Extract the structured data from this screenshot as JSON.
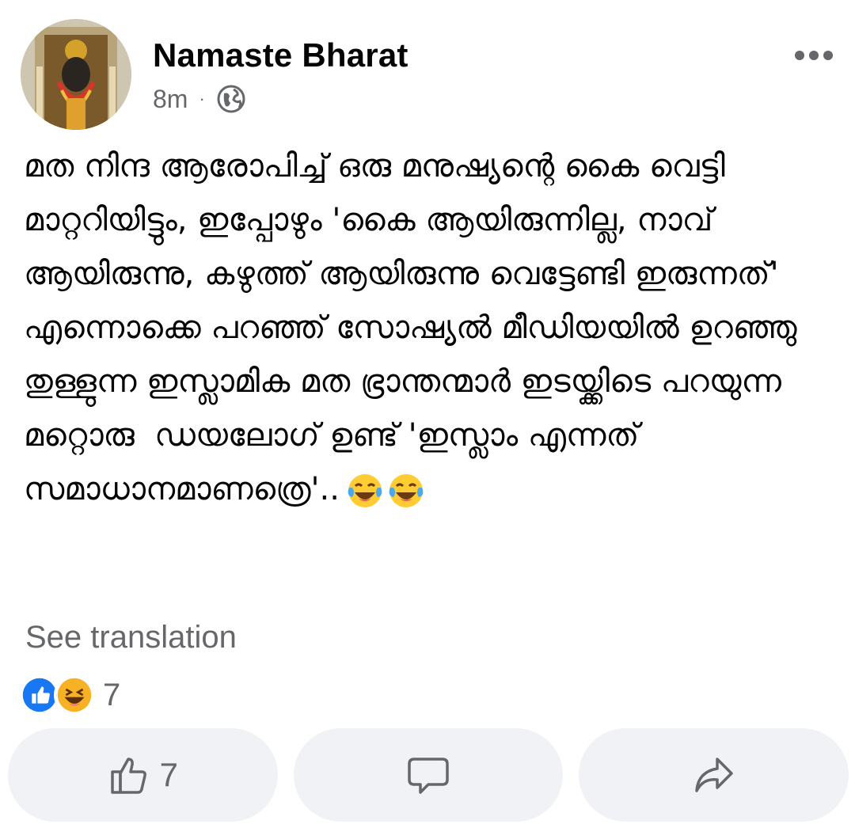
{
  "post": {
    "author": "Namaste Bharat",
    "time": "8m",
    "separator": "·",
    "audience_icon": "globe-icon",
    "text": "മത നിന്ദ ആരോപിച്ച് ഒരു മനുഷ്യന്റെ കൈ വെട്ടി മാറ്ററിയിട്ടും, ഇപ്പോഴും 'കൈ ആയിരുന്നില്ല, നാവ് ആയിരുന്നു, കഴുത്ത് ആയിരുന്നു വെട്ടേണ്ടി ഇരുന്നത്' എന്നൊക്കെ പറഞ്ഞ് സോഷ്യൽ മീഡിയയിൽ ഉറഞ്ഞു തുള്ളുന്ന ഇസ്ലാമിക മത ഭ്രാന്തന്മാർ ഇടയ്ക്കിടെ പറയുന്ന മറ്റൊരു  ഡയലോഗ് ഉണ്ട് 'ഇസ്ലാം എന്നത് സമാധാനമാണത്രെ'..",
    "trailing_emojis": "laughing-with-tears-emoji ×2",
    "see_translation": "See translation"
  },
  "reactions": {
    "icons": [
      "like-icon",
      "haha-icon"
    ],
    "count": "7"
  },
  "actions": {
    "like_count": "7",
    "like_icon": "thumbs-up-icon",
    "comment_icon": "comment-icon",
    "share_icon": "share-icon"
  },
  "colors": {
    "text": "#050505",
    "secondary": "#65676b",
    "button_bg": "#f0f2f5",
    "like_blue": "#1877f2",
    "haha_yellow": "#f7b125"
  }
}
